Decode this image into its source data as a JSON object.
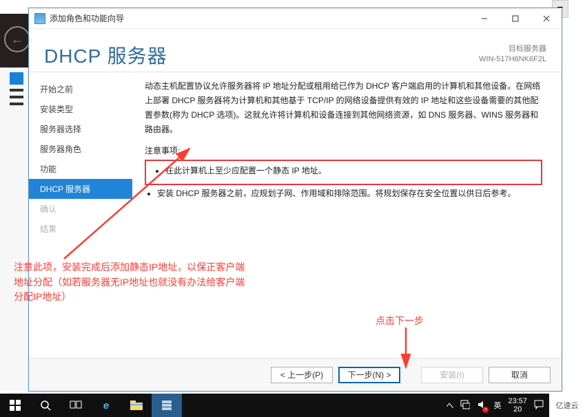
{
  "window": {
    "title": "添加角色和功能向导",
    "pageTitle": "DHCP 服务器",
    "targetLabel": "目标服务器",
    "targetServer": "WIN-517H6NK6F2L"
  },
  "nav": {
    "items": [
      {
        "label": "开始之前",
        "state": "done"
      },
      {
        "label": "安装类型",
        "state": "done"
      },
      {
        "label": "服务器选择",
        "state": "done"
      },
      {
        "label": "服务器角色",
        "state": "done"
      },
      {
        "label": "功能",
        "state": "done"
      },
      {
        "label": "DHCP 服务器",
        "state": "current"
      },
      {
        "label": "确认",
        "state": "pending"
      },
      {
        "label": "结果",
        "state": "pending"
      }
    ]
  },
  "content": {
    "intro": "动态主机配置协议允许服务器将 IP 地址分配或租用给已作为 DHCP 客户端启用的计算机和其他设备。在网络上部署 DHCP 服务器将为计算机和其他基于 TCP/IP 的网络设备提供有效的 IP 地址和这些设备需要的其他配置参数(称为 DHCP 选项)。这就允许将计算机和设备连接到其他网络资源，如 DNS 服务器、WINS 服务器和路由器。",
    "notesLabel": "注意事项:",
    "notes": [
      "在此计算机上至少应配置一个静态 IP 地址。",
      "安装 DHCP 服务器之前，应规划子网、作用域和排除范围。将规划保存在安全位置以供日后参考。"
    ]
  },
  "footer": {
    "prev": "< 上一步(P)",
    "next": "下一步(N) >",
    "install": "安装(I)",
    "cancel": "取消"
  },
  "annotations": {
    "sideNote": "注意此项，安装完成后添加静态IP地址，以保正客户端地址分配（如若服务器无IP地址也就没有办法给客户端分配IP地址）",
    "stepNote": "点击下一步"
  },
  "taskbar": {
    "ime": "英",
    "time": "23:57",
    "date": "20",
    "brand": "亿速云"
  }
}
